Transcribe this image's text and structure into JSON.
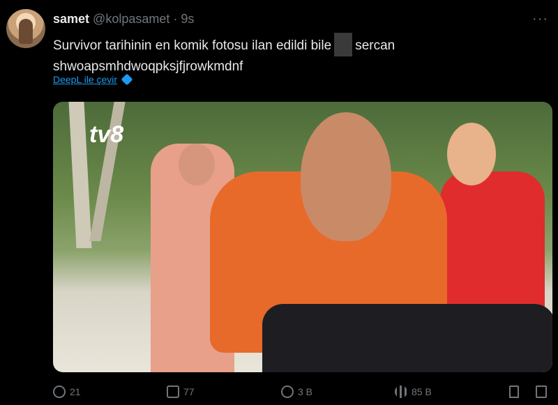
{
  "tweet": {
    "display_name": "samet",
    "handle": "@kolpasamet",
    "separator": "·",
    "time": "9s",
    "more_label": "···",
    "text_before": "Survivor tarihinin en komik fotosu ilan edildi bile",
    "text_after": "sercan",
    "text_line2": "shwoapsmhdwoqpksjfjrowkmdnf",
    "translate_label": "DeepL ile çevir",
    "media_logo": "tv8"
  },
  "actions": {
    "replies": "21",
    "reposts": "77",
    "likes": "3 B",
    "views": "85 B"
  },
  "colors": {
    "background": "#000000",
    "text": "#e7e9ea",
    "muted": "#71767b",
    "link": "#1d9bf0"
  }
}
